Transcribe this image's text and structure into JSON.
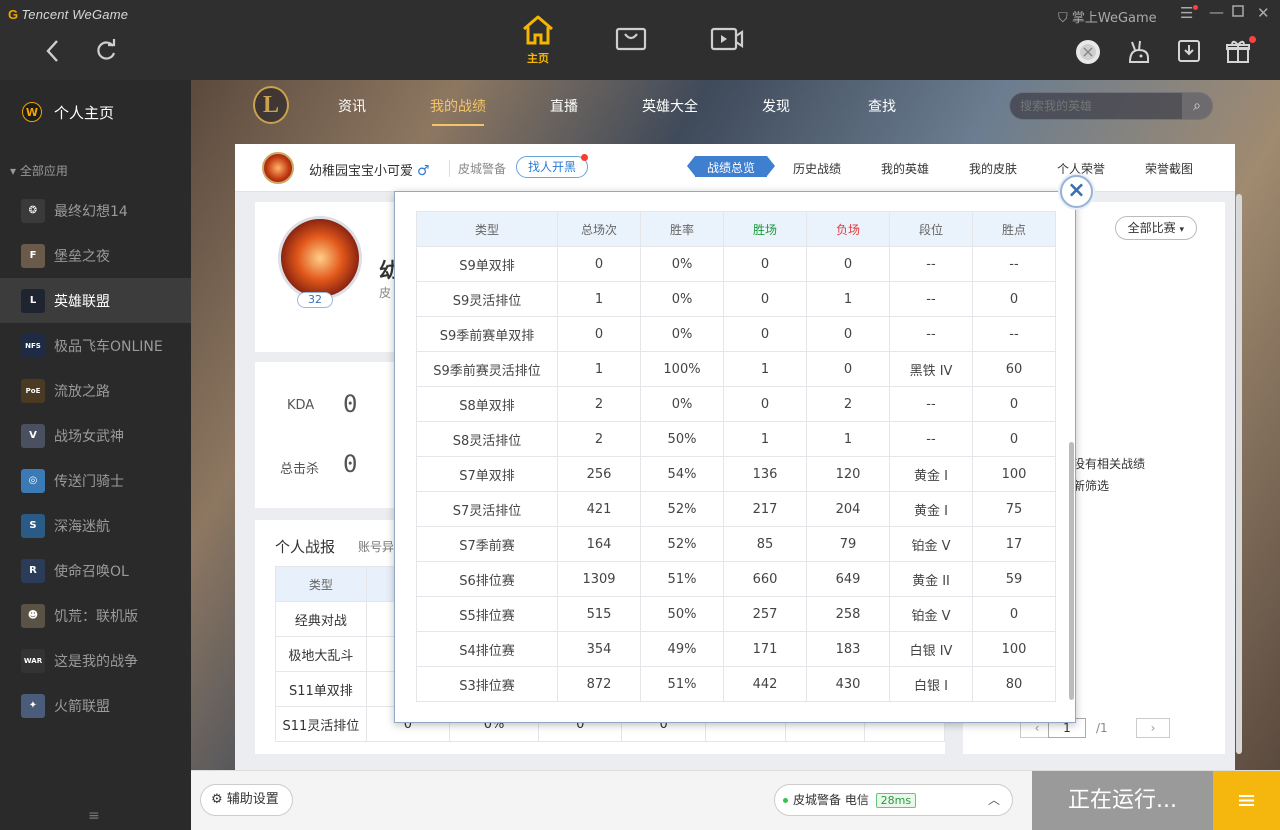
{
  "app": {
    "brand_prefix": "G",
    "brand": "Tencent WeGame",
    "mobile": "掌上WeGame"
  },
  "topnav": {
    "home_label": "主页"
  },
  "sidebar": {
    "home": "个人主页",
    "section": "全部应用",
    "items": [
      {
        "label": "最终幻想14",
        "icon": "ff14-icon",
        "color": "#3a3a3a",
        "glyph": "❂"
      },
      {
        "label": "堡垒之夜",
        "icon": "fortnite-icon",
        "color": "#6a5a4a",
        "glyph": "F"
      },
      {
        "label": "英雄联盟",
        "icon": "lol-icon",
        "color": "#1f2530",
        "glyph": "L",
        "active": true
      },
      {
        "label": "极品飞车ONLINE",
        "icon": "nfs-icon",
        "color": "#1e2b44",
        "glyph": "NFS"
      },
      {
        "label": "流放之路",
        "icon": "poe-icon",
        "color": "#4a3a24",
        "glyph": "PoE"
      },
      {
        "label": "战场女武神",
        "icon": "valkyria-icon",
        "color": "#4a5060",
        "glyph": "V"
      },
      {
        "label": "传送门骑士",
        "icon": "portal-knights-icon",
        "color": "#3a7ab5",
        "glyph": "◎"
      },
      {
        "label": "深海迷航",
        "icon": "subnautica-icon",
        "color": "#2a5a86",
        "glyph": "S"
      },
      {
        "label": "使命召唤OL",
        "icon": "cod-icon",
        "color": "#2a3c58",
        "glyph": "R"
      },
      {
        "label": "饥荒：联机版",
        "icon": "dont-starve-icon",
        "color": "#5a5244",
        "glyph": "☻"
      },
      {
        "label": "这是我的战争",
        "icon": "this-war-of-mine-icon",
        "color": "#333333",
        "glyph": "WAR"
      },
      {
        "label": "火箭联盟",
        "icon": "rocket-league-icon",
        "color": "#4a5c7a",
        "glyph": "✦"
      }
    ]
  },
  "lol": {
    "logo": "L",
    "nav": [
      "资讯",
      "我的战绩",
      "直播",
      "英雄大全",
      "发现",
      "查找"
    ],
    "nav_active": "我的战绩",
    "search_placeholder": "搜索我的英雄"
  },
  "player": {
    "name": "幼稚园宝宝小可爱",
    "gender_symbol": "♂",
    "server": "皮城警备",
    "find_btn": "找人开黑",
    "level": "32",
    "name_partial": "幼",
    "sub_partial": "皮"
  },
  "tabs": [
    "战绩总览",
    "历史战绩",
    "我的英雄",
    "我的皮肤",
    "个人荣誉",
    "荣誉截图"
  ],
  "tab_active": "战绩总览",
  "stats": {
    "kda_label": "KDA",
    "kda_value": "0",
    "kills_label": "总击杀",
    "kills_value": "0"
  },
  "report": {
    "title": "个人战报",
    "subtitle": "账号异",
    "header": "类型",
    "rows": [
      "经典对战",
      "极地大乱斗",
      "S11单双排",
      "S11灵活排位"
    ],
    "last_row_partial": [
      "0",
      "0%",
      "0",
      "0"
    ]
  },
  "right_panel": {
    "filter": "全部比赛",
    "no_data_1": "没有相关战绩",
    "no_data_2": "新筛选",
    "page": "1",
    "total": "/1"
  },
  "ranked_popup": {
    "columns": [
      "类型",
      "总场次",
      "胜率",
      "胜场",
      "负场",
      "段位",
      "胜点"
    ],
    "rows": [
      [
        "S9单双排",
        "0",
        "0%",
        "0",
        "0",
        "--",
        "--"
      ],
      [
        "S9灵活排位",
        "1",
        "0%",
        "0",
        "1",
        "--",
        "0"
      ],
      [
        "S9季前赛单双排",
        "0",
        "0%",
        "0",
        "0",
        "--",
        "--"
      ],
      [
        "S9季前赛灵活排位",
        "1",
        "100%",
        "1",
        "0",
        "黑铁 IV",
        "60"
      ],
      [
        "S8单双排",
        "2",
        "0%",
        "0",
        "2",
        "--",
        "0"
      ],
      [
        "S8灵活排位",
        "2",
        "50%",
        "1",
        "1",
        "--",
        "0"
      ],
      [
        "S7单双排",
        "256",
        "54%",
        "136",
        "120",
        "黄金 I",
        "100"
      ],
      [
        "S7灵活排位",
        "421",
        "52%",
        "217",
        "204",
        "黄金 I",
        "75"
      ],
      [
        "S7季前赛",
        "164",
        "52%",
        "85",
        "79",
        "铂金 V",
        "17"
      ],
      [
        "S6排位赛",
        "1309",
        "51%",
        "660",
        "649",
        "黄金 II",
        "59"
      ],
      [
        "S5排位赛",
        "515",
        "50%",
        "257",
        "258",
        "铂金 V",
        "0"
      ],
      [
        "S4排位赛",
        "354",
        "49%",
        "171",
        "183",
        "白银 IV",
        "100"
      ],
      [
        "S3排位赛",
        "872",
        "51%",
        "442",
        "430",
        "白银 I",
        "80"
      ]
    ]
  },
  "bottom": {
    "assist": "辅助设置",
    "server": "皮城警备 电信",
    "ping": "28ms",
    "running": "正在运行..."
  },
  "colors": {
    "accent": "#f5b70e",
    "win": "#1a9a3c",
    "loss": "#e23b3b",
    "link": "#2a7bd6"
  }
}
